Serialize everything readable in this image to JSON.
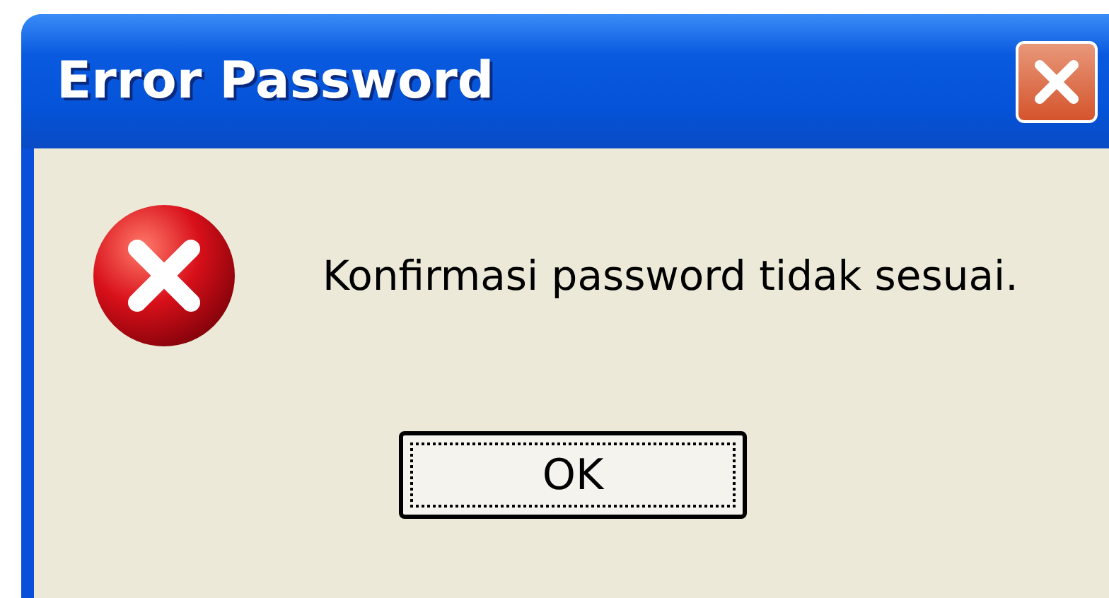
{
  "window": {
    "title": "Error Password"
  },
  "message": "Konfirmasi password tidak sesuai.",
  "buttons": [
    {
      "label": "OK",
      "focused": true
    }
  ]
}
